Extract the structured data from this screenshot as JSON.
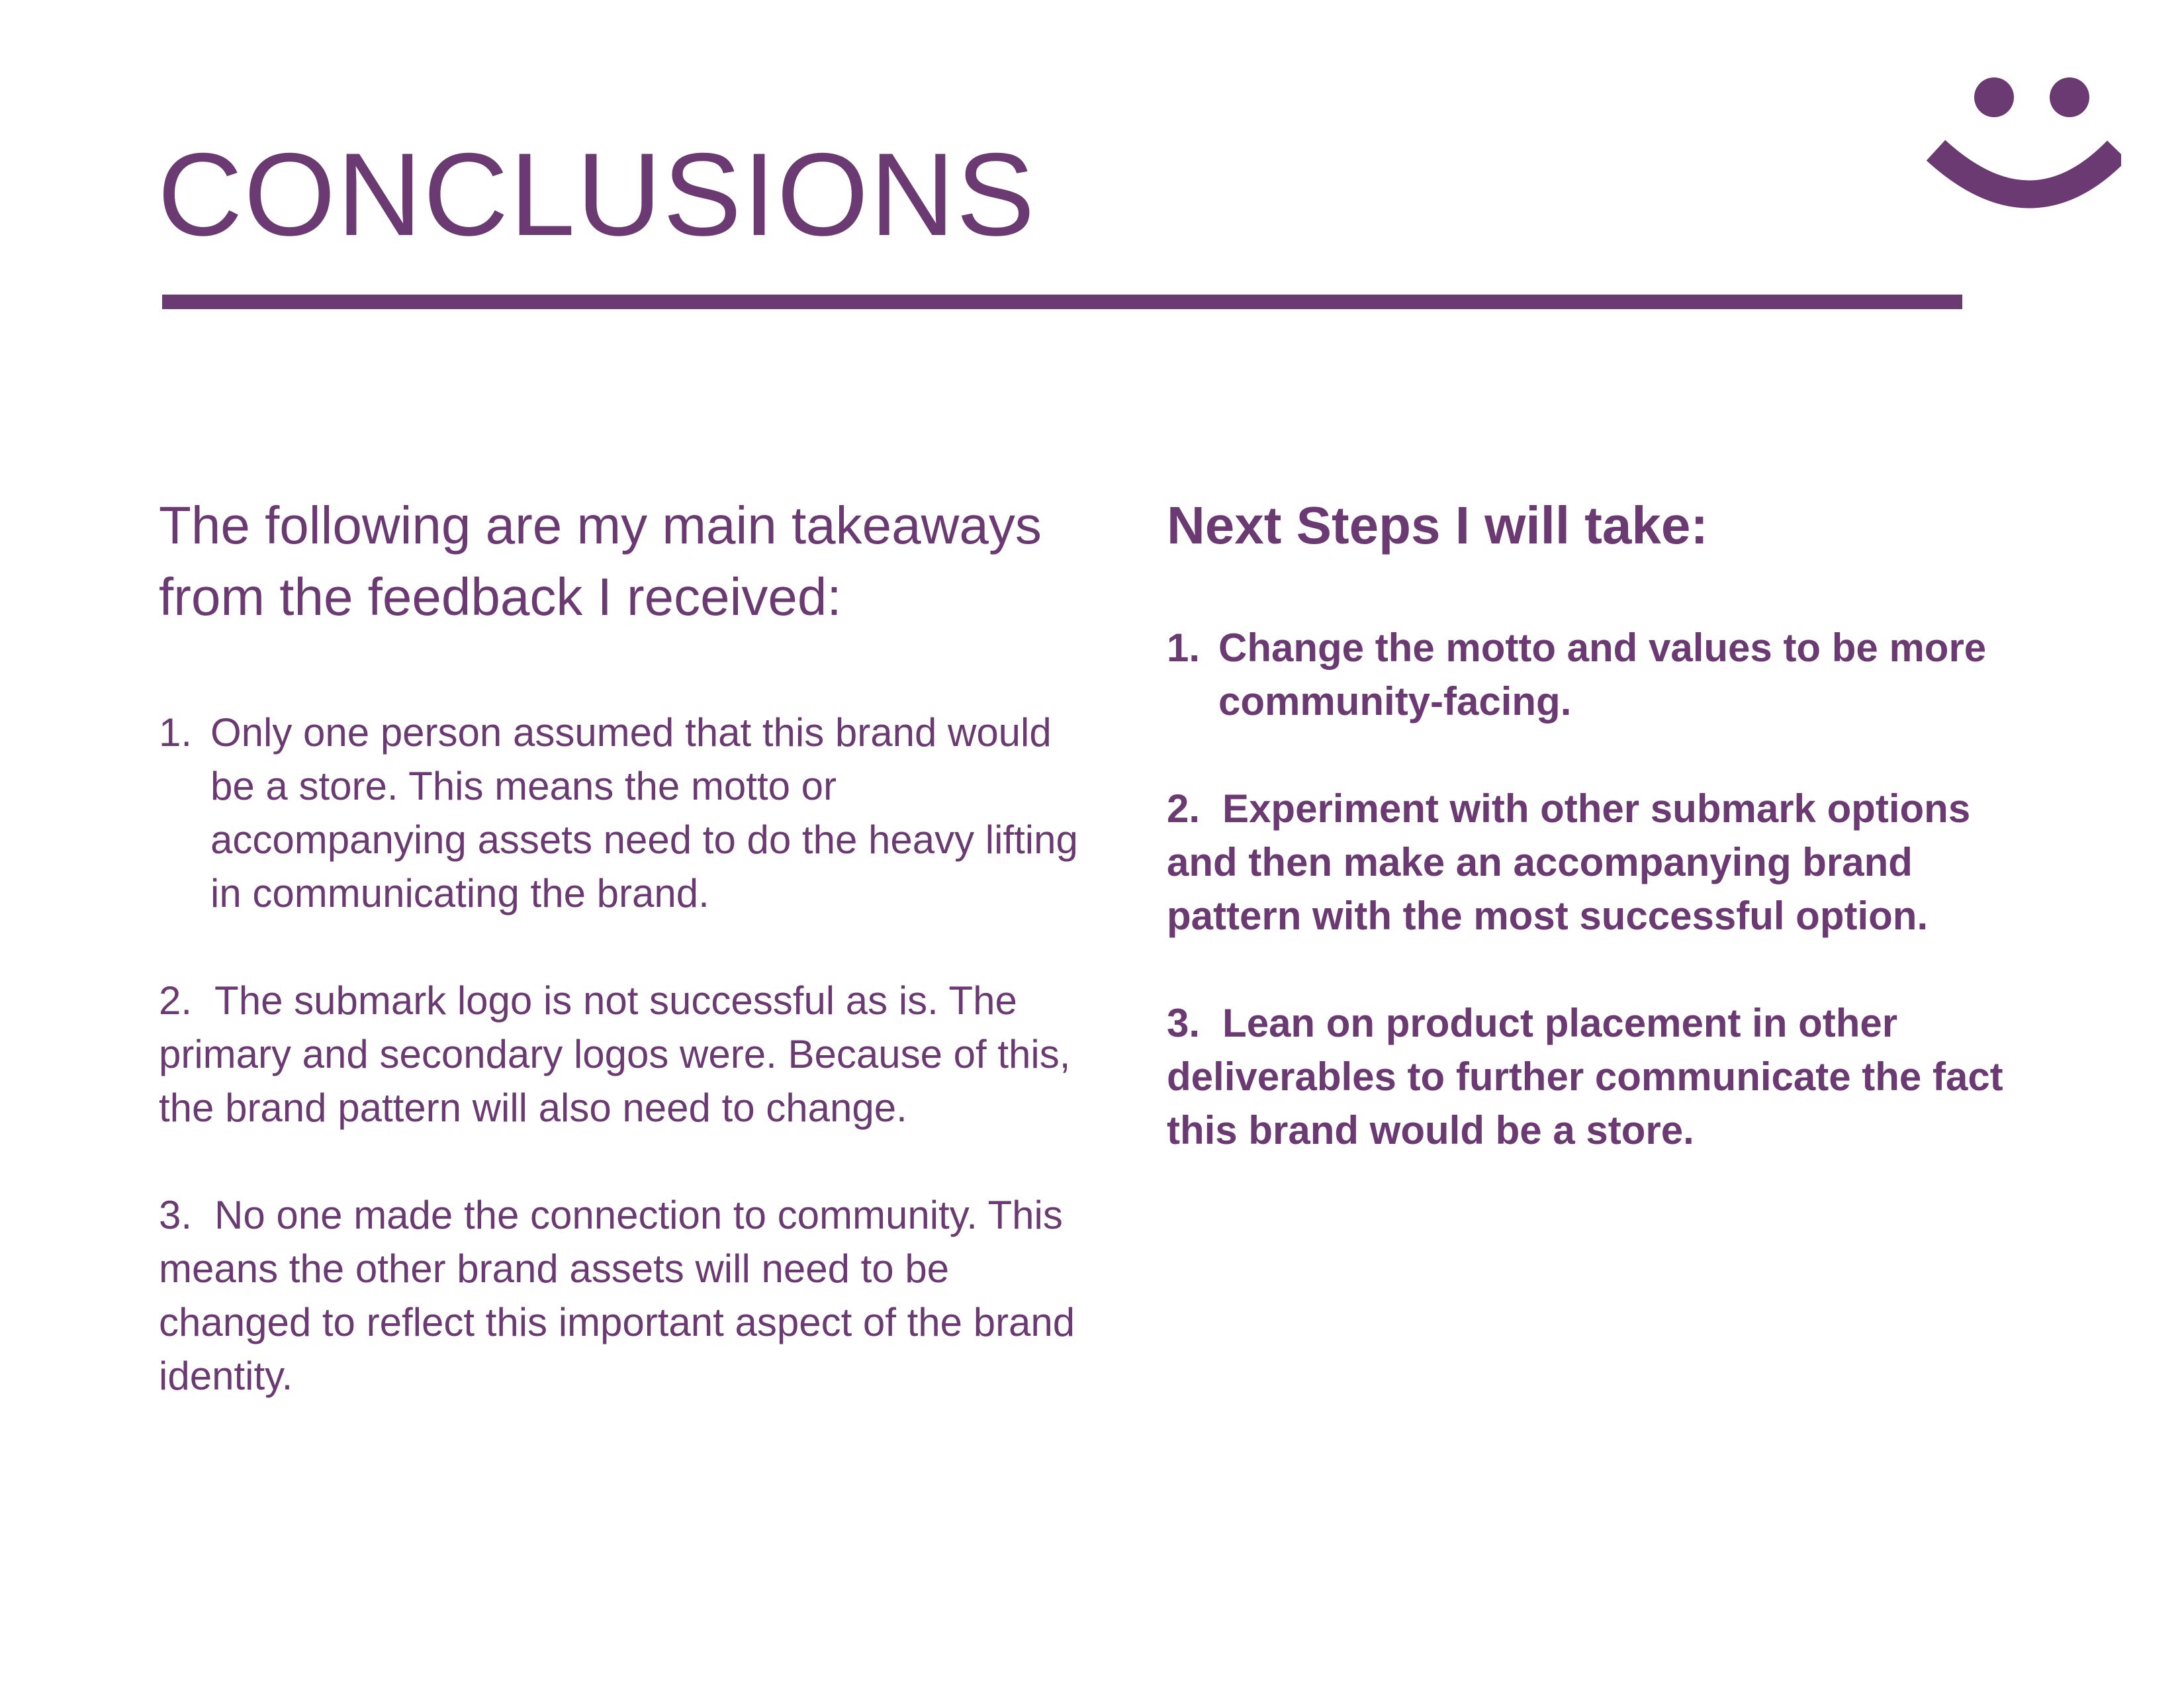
{
  "page": {
    "title": "CONCLUSIONS",
    "logo_icon": "smiley-face-icon",
    "accent_color": "#6b3a72"
  },
  "takeaways": {
    "intro": "The following are my main takeaways from the feedback I received:",
    "items": [
      {
        "number": "1.",
        "text": "Only one person assumed that this brand would be a store. This means the motto or accompanying assets need to do the heavy lifting in communicating the brand."
      },
      {
        "number": "2.",
        "text": "The submark logo is not successful as is. The primary and secondary logos were. Because of this, the brand pattern will also need to change."
      },
      {
        "number": "3.",
        "text": "No one made the connection to community. This means the other brand assets will need to be changed to reflect this important aspect of the brand identity."
      }
    ]
  },
  "next_steps": {
    "heading": "Next Steps I will take:",
    "items": [
      {
        "number": "1.",
        "text": "Change the motto and values to be more community-facing."
      },
      {
        "number": "2.",
        "text": "Experiment with other submark options and then make an accompanying brand pattern with the most successful option."
      },
      {
        "number": "3.",
        "text": "Lean on product placement in other deliverables to further communicate the fact this brand would be a store."
      }
    ]
  }
}
